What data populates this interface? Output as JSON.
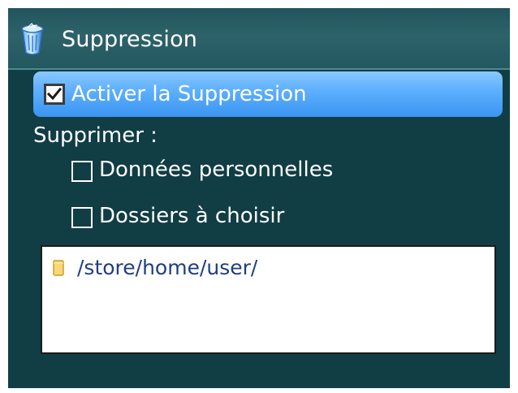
{
  "header": {
    "title": "Suppression",
    "icon": "trash-icon"
  },
  "settings": {
    "enable_label": "Activer la Suppression",
    "enable_checked": true,
    "delete_label": "Supprimer :",
    "options": [
      {
        "label": "Données personnelles",
        "checked": false
      },
      {
        "label": "Dossiers à choisir",
        "checked": false
      }
    ]
  },
  "folders": {
    "items": [
      {
        "path": "/store/home/user/",
        "icon": "folder-icon"
      }
    ]
  },
  "colors": {
    "background": "#113d45",
    "title_bar": "#2d6269",
    "selected_row": "#5fb0ff",
    "folder_text": "#1f3f80"
  }
}
